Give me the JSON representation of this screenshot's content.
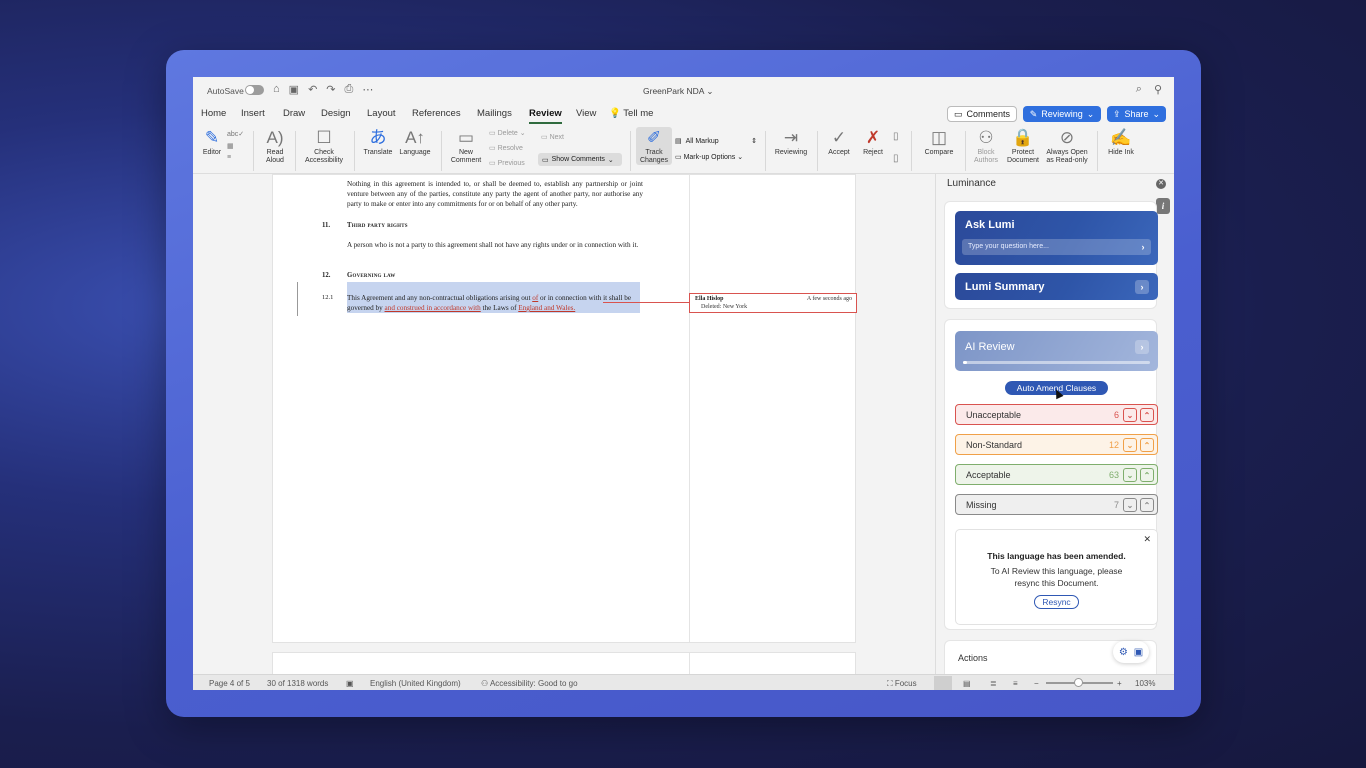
{
  "titlebar": {
    "autosave_label": "AutoSave",
    "doc_title": "GreenPark NDA"
  },
  "tabs": [
    "Home",
    "Insert",
    "Draw",
    "Design",
    "Layout",
    "References",
    "Mailings",
    "Review",
    "View",
    "Tell me"
  ],
  "header_buttons": {
    "comments": "Comments",
    "reviewing": "Reviewing",
    "share": "Share"
  },
  "ribbon": {
    "editor": "Editor",
    "read_aloud": "Read\nAloud",
    "check_accessibility": "Check\nAccessibility",
    "translate": "Translate",
    "language": "Language",
    "new_comment": "New\nComment",
    "delete": "Delete",
    "resolve": "Resolve",
    "next": "Next",
    "previous": "Previous",
    "show_comments": "Show Comments",
    "track_changes": "Track\nChanges",
    "all_markup": "All Markup",
    "markup_options": "Mark-up Options",
    "reviewing": "Reviewing",
    "accept": "Accept",
    "reject": "Reject",
    "compare": "Compare",
    "block_authors": "Block\nAuthors",
    "protect_document": "Protect\nDocument",
    "always_open_read_only": "Always Open\nas Read-only",
    "hide_ink": "Hide Ink"
  },
  "document": {
    "para_top": "Nothing in this agreement is intended to, or shall be deemed to, establish any partnership or joint venture between any of the parties, constitute any party the agent of another party, nor authorise any party to make or enter into any commitments for or on behalf of any other party.",
    "s11_num": "11.",
    "s11_head": "Third party rights",
    "s11_text": "A person who is not a party to this agreement shall not have any rights under or in connection with it.",
    "s12_num": "12.",
    "s12_head": "Governing law",
    "s121_num": "12.1",
    "s121_a": "This Agreement and any non-contractual obligations arising out ",
    "s121_ins1": "of",
    "s121_b": " or in connection with it shall be governed by ",
    "s121_ins2": "and construed in accordance with",
    "s121_c": " the Laws of ",
    "s121_ins3": "England and Wales.",
    "comment": {
      "author": "Ella Hislop",
      "time": "A few seconds ago",
      "deleted": "Deleted: New York"
    }
  },
  "panel": {
    "title": "Luminance",
    "ask_lumi": "Ask Lumi",
    "ask_placeholder": "Type your question here...",
    "lumi_summary": "Lumi Summary",
    "ai_review": "AI Review",
    "ai_review_progress": 0.02,
    "auto_amend": "Auto Amend Clauses",
    "categories": [
      {
        "label": "Unacceptable",
        "count": "6",
        "color": "#d9534f",
        "bg": "#fbeaea"
      },
      {
        "label": "Non-Standard",
        "count": "12",
        "color": "#f0a048",
        "bg": "#fdf3e7"
      },
      {
        "label": "Acceptable",
        "count": "63",
        "color": "#7fae6d",
        "bg": "#eef4ea"
      },
      {
        "label": "Missing",
        "count": "7",
        "color": "#8a8a8a",
        "bg": "#efefef"
      }
    ],
    "notice_title": "This language has been amended.",
    "notice_body": "To AI Review this language, please resync this Document.",
    "resync": "Resync",
    "actions": "Actions"
  },
  "statusbar": {
    "page": "Page 4 of 5",
    "words": "30 of 1318 words",
    "language": "English (United Kingdom)",
    "accessibility": "Accessibility: Good to go",
    "focus": "Focus",
    "zoom": "103%"
  },
  "colors": {
    "accent": "#2f6fde",
    "lumi": "#2c4a9a",
    "tab_underline": "#2f6b3e"
  }
}
